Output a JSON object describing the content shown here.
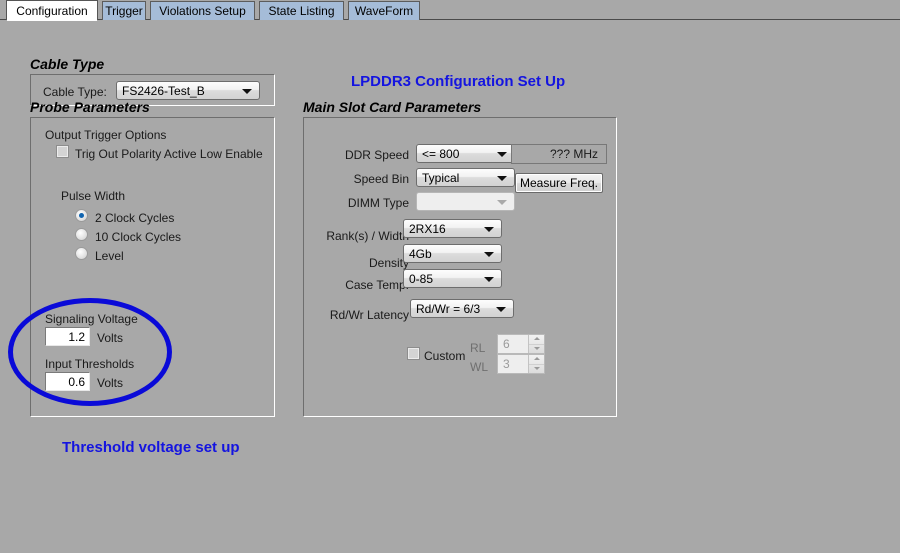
{
  "window": {
    "title": "LPDDR3 Configuration Set Up",
    "background_color": "#a8a8a8"
  },
  "tabs": [
    {
      "label": "Configuration",
      "active": true
    },
    {
      "label": "Trigger",
      "active": false
    },
    {
      "label": "Violations Setup",
      "active": false
    },
    {
      "label": "State Listing",
      "active": false
    },
    {
      "label": "WaveForm",
      "active": false
    }
  ],
  "annotations": {
    "title": "LPDDR3 Configuration Set Up",
    "caption": "Threshold voltage set up",
    "color": "#1414e0"
  },
  "cable_type": {
    "group_label": "Cable Type",
    "field_label": "Cable Type:",
    "value": "FS2426-Test_B"
  },
  "probe_parameters": {
    "group_label": "Probe Parameters",
    "output_trigger_options_label": "Output Trigger Options",
    "trig_out_polarity": {
      "label": "Trig Out Polarity Active Low Enable",
      "checked": false
    },
    "pulse_width": {
      "label": "Pulse Width",
      "options": [
        {
          "label": "2 Clock Cycles",
          "selected": true
        },
        {
          "label": "10 Clock Cycles",
          "selected": false
        },
        {
          "label": "Level",
          "selected": false
        }
      ]
    },
    "signaling_voltage": {
      "label": "Signaling Voltage",
      "value": "1.2",
      "unit": "Volts"
    },
    "input_thresholds": {
      "label": "Input Thresholds",
      "value": "0.6",
      "unit": "Volts"
    }
  },
  "main_slot_card": {
    "group_label": "Main Slot Card Parameters",
    "fields": [
      {
        "label": "DDR Speed",
        "value": "<= 800",
        "disabled": false
      },
      {
        "label": "Speed Bin",
        "value": "Typical",
        "disabled": false
      },
      {
        "label": "DIMM Type",
        "value": "",
        "disabled": true
      },
      {
        "label": "Rank(s) / Width",
        "value": "2RX16",
        "disabled": false
      },
      {
        "label": "Density",
        "value": "4Gb",
        "disabled": false
      },
      {
        "label": "Case Temp.",
        "value": "0-85",
        "disabled": false
      },
      {
        "label": "Rd/Wr Latency",
        "value": "Rd/Wr = 6/3",
        "disabled": false
      }
    ],
    "frequency_readout": "???  MHz",
    "measure_button": "Measure Freq.",
    "custom": {
      "label": "Custom",
      "checked": false,
      "rl_label": "RL",
      "rl_value": "6",
      "wl_label": "WL",
      "wl_value": "3"
    }
  }
}
